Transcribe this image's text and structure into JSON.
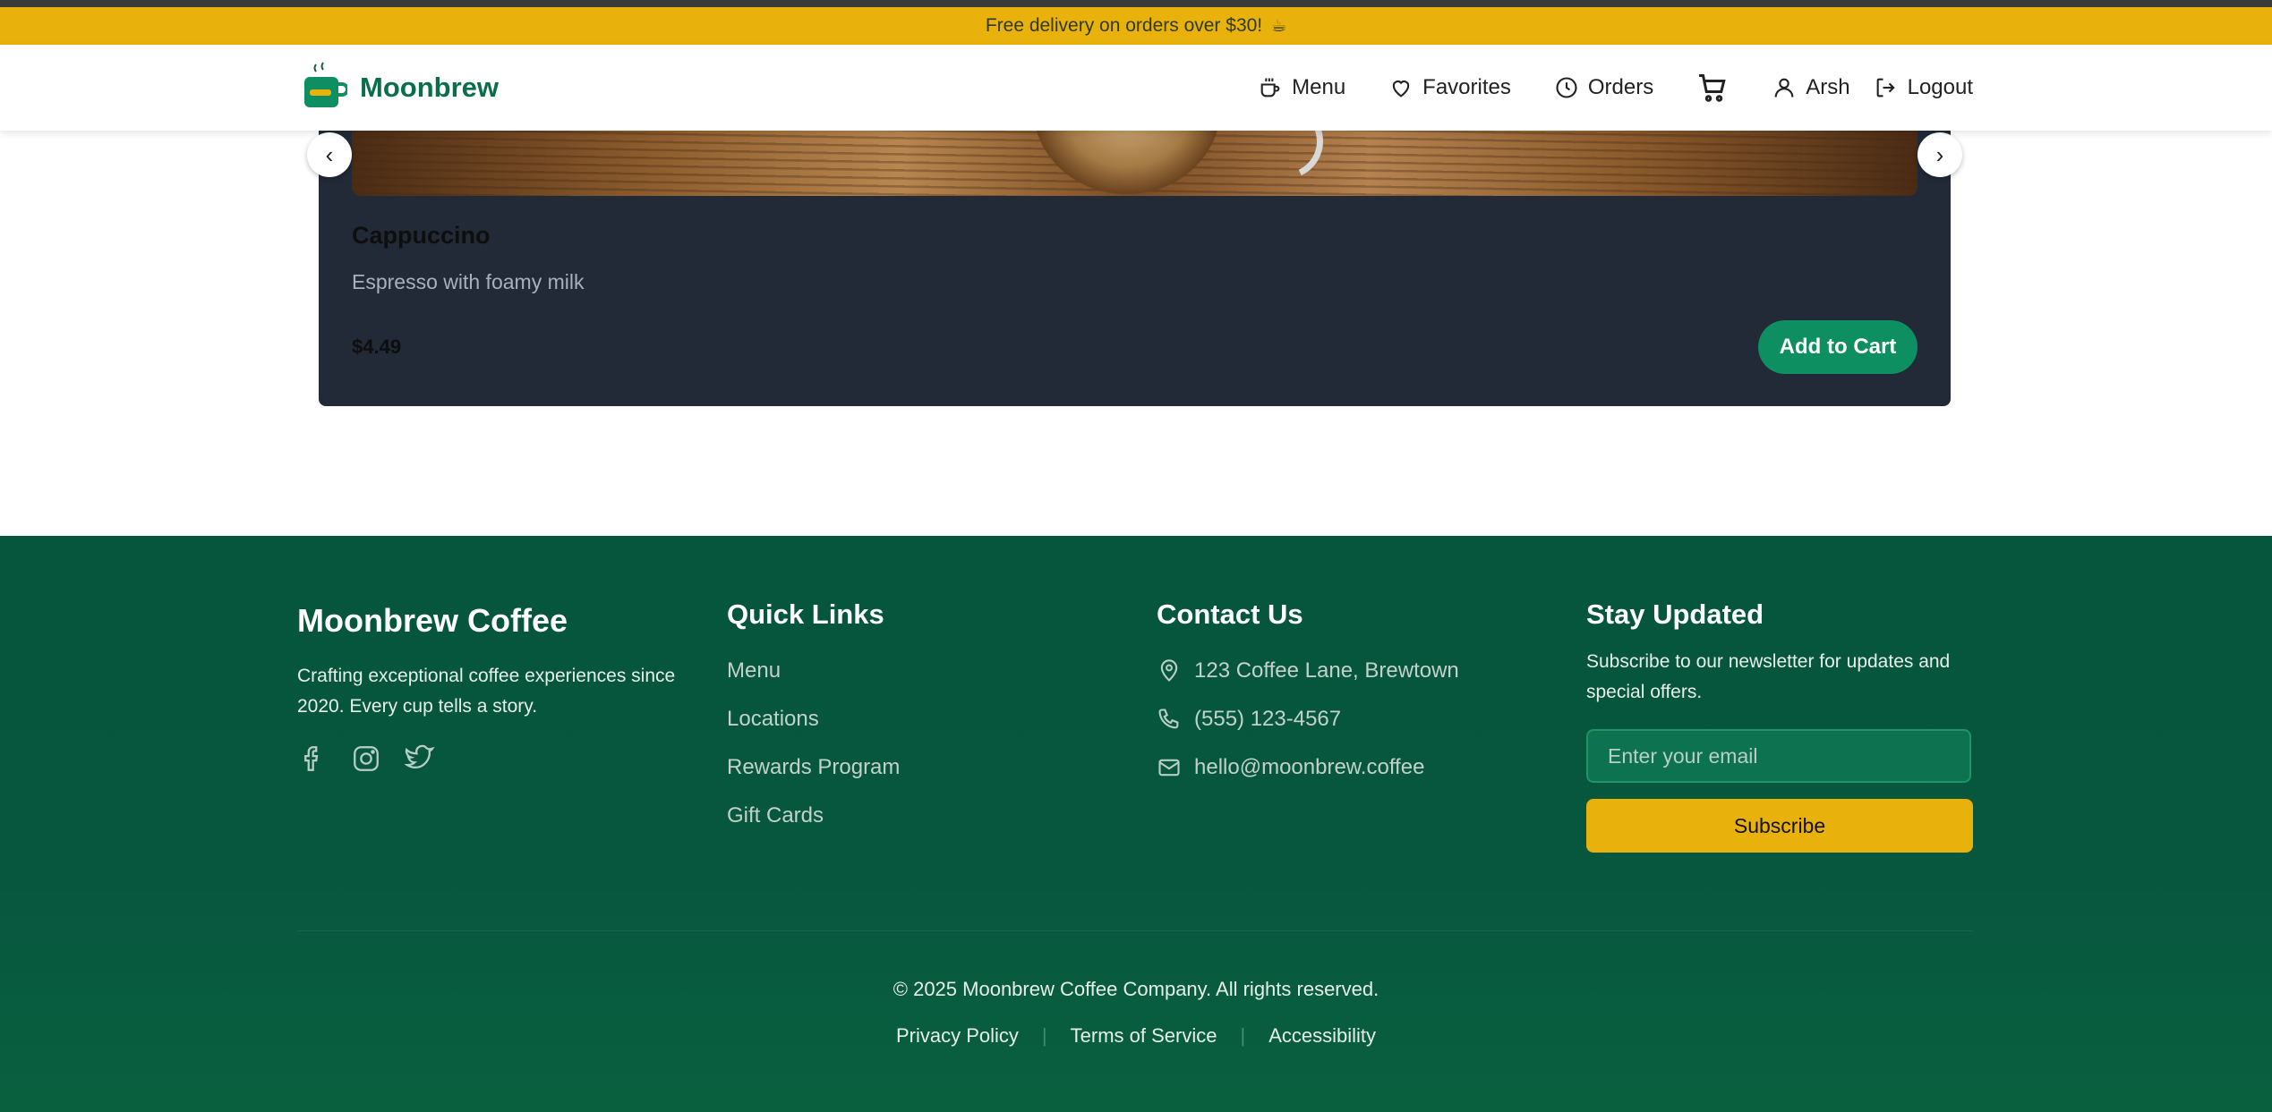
{
  "promo": {
    "text": "Free delivery on orders over $30!",
    "emoji": "☕"
  },
  "header": {
    "brand": "Moonbrew",
    "nav": {
      "menu": "Menu",
      "favorites": "Favorites",
      "orders": "Orders",
      "user": "Arsh",
      "logout": "Logout"
    }
  },
  "product": {
    "name": "Cappuccino",
    "description": "Espresso with foamy milk",
    "price": "$4.49",
    "add_to_cart": "Add to Cart",
    "prev_arrow": "‹",
    "next_arrow": "›"
  },
  "footer": {
    "about": {
      "title": "Moonbrew Coffee",
      "text_line1": "Crafting exceptional coffee experiences since",
      "text_line2": "2020. Every cup tells a story.",
      "social_icons": [
        "facebook-icon",
        "instagram-icon",
        "twitter-icon"
      ]
    },
    "quick_links": {
      "title": "Quick Links",
      "items": [
        "Menu",
        "Locations",
        "Rewards Program",
        "Gift Cards"
      ]
    },
    "contact": {
      "title": "Contact Us",
      "address": "123 Coffee Lane, Brewtown",
      "phone": "(555) 123-4567",
      "email": "hello@moonbrew.coffee"
    },
    "newsletter": {
      "title": "Stay Updated",
      "text_line1": "Subscribe to our newsletter for updates and",
      "text_line2": "special offers.",
      "placeholder": "Enter your email",
      "button": "Subscribe"
    },
    "copyright": "© 2025 Moonbrew Coffee Company. All rights reserved.",
    "legal": [
      "Privacy Policy",
      "Terms of Service",
      "Accessibility"
    ]
  },
  "colors": {
    "accent_yellow": "#e9b10b",
    "brand_green": "#0b6e4a",
    "footer_green": "#06553d",
    "button_green": "#0e8f62",
    "card_dark": "#222a38"
  }
}
